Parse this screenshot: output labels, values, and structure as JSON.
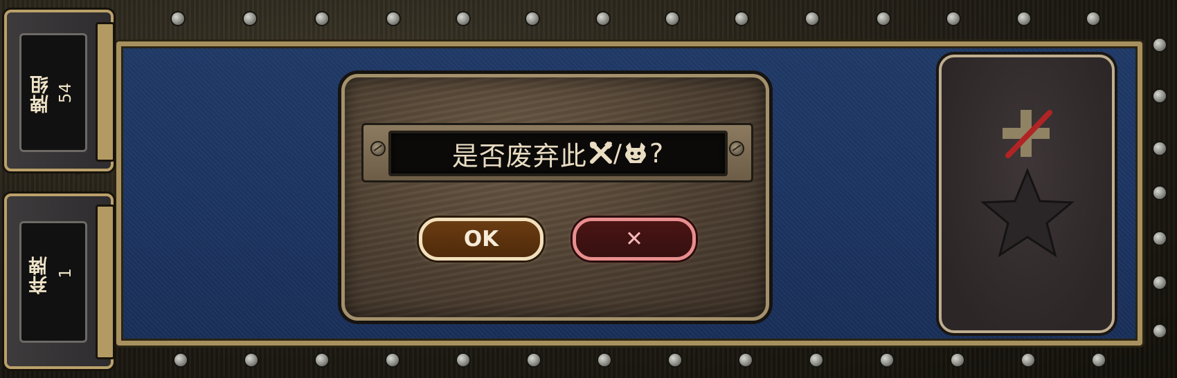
{
  "deck_pile": {
    "label": "牌组",
    "count": "54"
  },
  "discard_pile": {
    "label": "弃牌",
    "count": "1"
  },
  "dialog": {
    "question": "是否废弃此",
    "question_suffix": "?",
    "ok_label": "OK",
    "cancel_label": "✕"
  },
  "card_slot": {
    "disabled_icon": "no-plus-icon",
    "star_icon": "star-icon"
  },
  "colors": {
    "board": "#1d3563",
    "frame_brass": "#a8915e",
    "ok_border": "#f2dfbc",
    "cancel_border": "#e88e8e",
    "disabled_slash": "#b12424"
  }
}
